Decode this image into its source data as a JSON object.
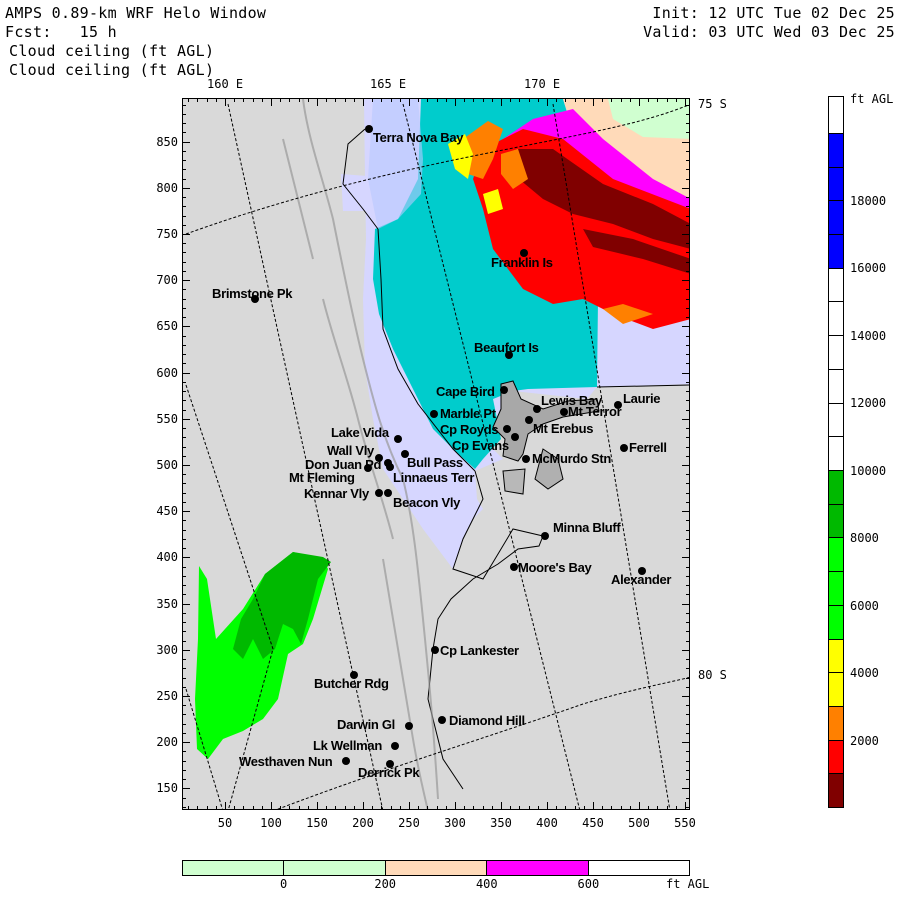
{
  "header": {
    "title": "AMPS 0.89-km WRF Helo Window",
    "fcst": "Fcst:   15 h",
    "init": "Init: 12 UTC Tue 02 Dec 25",
    "valid": "Valid: 03 UTC Wed 03 Dec 25",
    "field_1": "Cloud ceiling (ft AGL)",
    "field_2": "Cloud ceiling (ft AGL)"
  },
  "map": {
    "lon_labels": [
      "160 E",
      "165 E",
      "170 E"
    ],
    "lat_labels": [
      "75 S",
      "80 S"
    ],
    "x_tick_labels": [
      "50",
      "100",
      "150",
      "200",
      "250",
      "300",
      "350",
      "400",
      "450",
      "500",
      "550"
    ],
    "y_tick_labels": [
      "850",
      "800",
      "750",
      "700",
      "650",
      "600",
      "550",
      "500",
      "450",
      "400",
      "350",
      "300",
      "250",
      "200",
      "150"
    ],
    "stations": [
      {
        "name": "Terra Nova Bay"
      },
      {
        "name": "Franklin Is"
      },
      {
        "name": "Brimstone Pk"
      },
      {
        "name": "Beaufort Is"
      },
      {
        "name": "Cape Bird"
      },
      {
        "name": "Marble Pt"
      },
      {
        "name": "Lewis Bay"
      },
      {
        "name": "Mt Terror"
      },
      {
        "name": "Laurie"
      },
      {
        "name": "Lake Vida"
      },
      {
        "name": "Cp Royds"
      },
      {
        "name": "Mt Erebus"
      },
      {
        "name": "Cp Evans"
      },
      {
        "name": "Ferrell"
      },
      {
        "name": "Wall Vly"
      },
      {
        "name": "Bull Pass"
      },
      {
        "name": "McMurdo Stn"
      },
      {
        "name": "Don Juan Pd"
      },
      {
        "name": "Mt Fleming"
      },
      {
        "name": "Linnaeus Terr"
      },
      {
        "name": "Kennar Vly"
      },
      {
        "name": "Beacon Vly"
      },
      {
        "name": "Minna Bluff"
      },
      {
        "name": "Moore's Bay"
      },
      {
        "name": "Alexander"
      },
      {
        "name": "Cp Lankester"
      },
      {
        "name": "Butcher Rdg"
      },
      {
        "name": "Darwin Gl"
      },
      {
        "name": "Diamond Hill"
      },
      {
        "name": "Lk Wellman"
      },
      {
        "name": "Westhaven Nun"
      },
      {
        "name": "Derrick Pk"
      }
    ]
  },
  "colorbar_right": {
    "unit": "ft AGL",
    "labels": [
      "18000",
      "16000",
      "14000",
      "12000",
      "10000",
      "8000",
      "6000",
      "4000",
      "2000"
    ],
    "colors": [
      "#ffffff",
      "#0000ff",
      "#0000ff",
      "#0000ff",
      "#0000ff",
      "#ffffff",
      "#ffffff",
      "#ffffff",
      "#ffffff",
      "#ffffff",
      "#ffffff",
      "#00b900",
      "#00b900",
      "#00ff00",
      "#00ff00",
      "#00ff00",
      "#ffff00",
      "#ffff00",
      "#ff8000",
      "#ff0000",
      "#800000"
    ]
  },
  "colorbar_bottom": {
    "unit": "ft AGL",
    "labels": [
      "0",
      "200",
      "400",
      "600"
    ],
    "colors": [
      "#d0ffd0",
      "#d0ffd0",
      "#ffdab9",
      "#ff00ff",
      "#ffffff"
    ]
  }
}
